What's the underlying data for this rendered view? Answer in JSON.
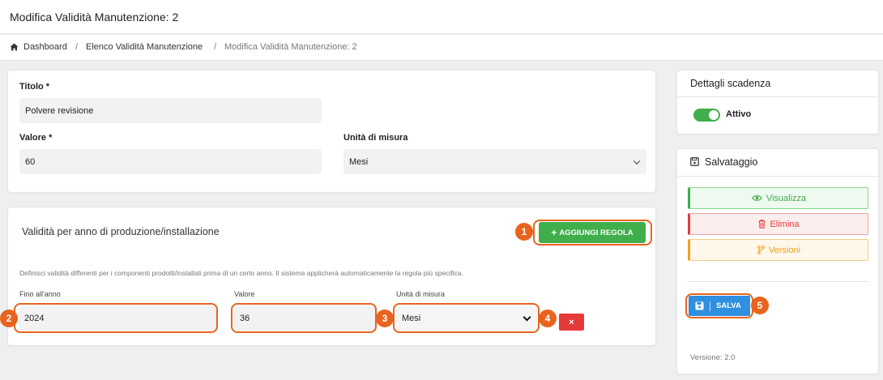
{
  "header": {
    "title": "Modifica Validità Manutenzione: 2"
  },
  "breadcrumb": {
    "items": [
      {
        "label": "Dashboard",
        "icon": "home-icon"
      },
      {
        "label": "Elenco Validità Manutenzione"
      },
      {
        "label": "Modifica Validità Manutenzione: 2"
      }
    ],
    "separator": "/"
  },
  "main_form": {
    "titolo_label": "Titolo *",
    "titolo_value": "Polvere revisione",
    "valore_label": "Valore *",
    "valore_value": "60",
    "unita_label": "Unità di misura",
    "unita_value": "Mesi"
  },
  "rules": {
    "title": "Validità per anno di produzione/installazione",
    "add_button_label": "AGGIUNGI REGOLA",
    "hint": "Definisci validità differenti per i componenti prodotti/installati prima di un certo anno. Il sistema applicherà automaticamente la regola più specifica.",
    "col_fino_label": "Fino all'anno",
    "col_valore_label": "Valore",
    "col_unita_label": "Unità di misura",
    "row": {
      "fino": "2024",
      "valore": "36",
      "unita": "Mesi"
    },
    "delete_glyph": "×"
  },
  "dettagli": {
    "title": "Dettagli scadenza",
    "attivo_label": "Attivo",
    "attivo_on": true
  },
  "salvataggio": {
    "title": "Salvataggio",
    "visualizza_label": "Visualizza",
    "elimina_label": "Elimina",
    "versioni_label": "Versioni",
    "salva_label": "SALVA",
    "versione_text": "Versione: 2.0"
  },
  "callouts": [
    "1",
    "2",
    "3",
    "4",
    "5"
  ],
  "colors": {
    "accent_orange": "#e8641e",
    "success_green": "#3fae4b",
    "danger_red": "#e53a3a",
    "warning_orange": "#f0a01e",
    "primary_blue": "#2f8fe0"
  }
}
